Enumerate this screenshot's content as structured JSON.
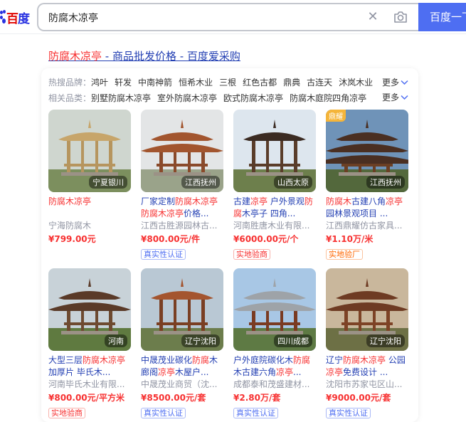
{
  "header": {
    "logo_bai": "百",
    "logo_du": "度",
    "search_value": "防腐木凉亭",
    "search_button": "百度一下"
  },
  "result": {
    "title_hl": "防腐木凉亭",
    "title_rest": " - 商品批发价格 - 百度爱采购"
  },
  "filters": {
    "hot_label": "热搜品牌：",
    "hot_items": [
      "鸿叶",
      "轩发",
      "中南神箭",
      "恒希木业",
      "三根",
      "红色古都",
      "鼎典",
      "古连天",
      "沐岚木业"
    ],
    "related_label": "相关品类：",
    "related_items": [
      "别墅防腐木凉亭",
      "室外防腐木凉亭",
      "欧式防腐木凉亭",
      "防腐木庭院四角凉亭"
    ],
    "more_label": "更多"
  },
  "products": [
    {
      "loc": "宁夏银川",
      "badge": "",
      "title": [
        [
          "hl",
          "防腐木凉亭"
        ]
      ],
      "company": "宁海防腐木",
      "price": "¥799.00元",
      "tag": "",
      "tag_type": ""
    },
    {
      "loc": "江西抚州",
      "badge": "",
      "title": [
        [
          "n",
          "厂家定制"
        ],
        [
          "hl",
          "防腐木凉亭"
        ],
        [
          "n",
          " "
        ],
        [
          "hl",
          "防腐木凉亭"
        ],
        [
          "n",
          "价格..."
        ]
      ],
      "company": "江西古胜源园林古...",
      "price": "¥800.00元/件",
      "tag": "真实性认证",
      "tag_type": "real"
    },
    {
      "loc": "山西太原",
      "badge": "",
      "title": [
        [
          "n",
          "古建"
        ],
        [
          "hl",
          "凉亭"
        ],
        [
          "n",
          " 户外景观"
        ],
        [
          "hl",
          "防腐"
        ],
        [
          "n",
          "木亭子 四角..."
        ]
      ],
      "company": "河南胜唐木业有限...",
      "price": "¥6000.00元/个",
      "tag": "实地验商",
      "tag_type": "visit"
    },
    {
      "loc": "江西抚州",
      "badge": "鼎耀",
      "title": [
        [
          "hl",
          "防腐木"
        ],
        [
          "n",
          "古建八角"
        ],
        [
          "hl",
          "凉亭"
        ],
        [
          "n",
          " 园林景观项目 ..."
        ]
      ],
      "company": "江西鼎耀仿古家具...",
      "price": "¥1.10万/米",
      "tag": "实地验厂",
      "tag_type": "factory"
    },
    {
      "loc": "河南",
      "badge": "",
      "title": [
        [
          "n",
          "大型三层"
        ],
        [
          "hl",
          "防腐木凉亭"
        ],
        [
          "n",
          " 加厚片 毕氏木..."
        ]
      ],
      "company": "河南毕氏木业有限...",
      "price": "¥800.00元/平方米",
      "tag": "实地验商",
      "tag_type": "visit"
    },
    {
      "loc": "辽宁沈阳",
      "badge": "",
      "title": [
        [
          "n",
          "中晟茂业碳化"
        ],
        [
          "hl",
          "防腐"
        ],
        [
          "n",
          "木 廊阁"
        ],
        [
          "hl",
          "凉亭"
        ],
        [
          "n",
          "木屋户..."
        ]
      ],
      "company": "中晟茂业商贸（沈...",
      "price": "¥8500.00元/套",
      "tag": "真实性认证",
      "tag_type": "real"
    },
    {
      "loc": "四川成都",
      "badge": "",
      "title": [
        [
          "n",
          "户外庭院碳化木"
        ],
        [
          "hl",
          "防腐"
        ],
        [
          "n",
          " 木古建六角"
        ],
        [
          "hl",
          "凉亭"
        ],
        [
          "n",
          "..."
        ]
      ],
      "company": "成都泰和茂盛建材...",
      "price": "¥2.80万/套",
      "tag": "真实性认证",
      "tag_type": "real"
    },
    {
      "loc": "辽宁沈阳",
      "badge": "",
      "title": [
        [
          "n",
          "辽宁"
        ],
        [
          "hl",
          "防腐木凉亭"
        ],
        [
          "n",
          " 公园"
        ],
        [
          "hl",
          "凉亭"
        ],
        [
          "n",
          "免费设计 ..."
        ]
      ],
      "company": "沈阳市苏家屯区山...",
      "price": "¥9000.00元/套",
      "tag": "真实性认证",
      "tag_type": "real"
    }
  ]
}
